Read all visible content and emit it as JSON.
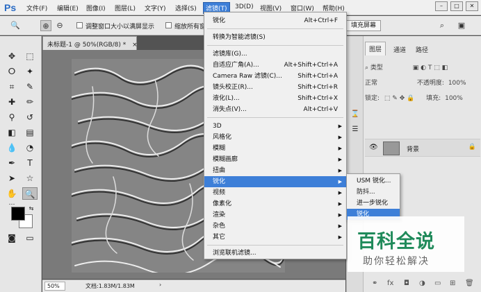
{
  "app": {
    "logo": "Ps"
  },
  "menubar": {
    "items": [
      "文件(F)",
      "编辑(E)",
      "图像(I)",
      "图层(L)",
      "文字(Y)",
      "选择(S)",
      "滤镜(T)",
      "3D(D)",
      "视图(V)",
      "窗口(W)",
      "帮助(H)"
    ],
    "active": "滤镜(T)"
  },
  "window_buttons": {
    "minimize": "–",
    "restore": "□",
    "close": "✕"
  },
  "options_bar": {
    "zoom_icon": "zoom-icon",
    "check1_label": "调整窗口大小以满屏显示",
    "check2_label": "缩放所有窗口",
    "fill_screen": "填充屏幕"
  },
  "document": {
    "tab_title": "未标题-1 @ 50%(RGB/8) *",
    "zoom": "50%",
    "doc_info": "文档:1.83M/1.83M"
  },
  "filter_menu": {
    "last_filter": {
      "label": "锐化",
      "shortcut": "Alt+Ctrl+F"
    },
    "smart": "转换为智能滤镜(S)",
    "group2": [
      {
        "label": "滤镜库(G)...",
        "shortcut": ""
      },
      {
        "label": "自适应广角(A)...",
        "shortcut": "Alt+Shift+Ctrl+A"
      },
      {
        "label": "Camera Raw 滤镜(C)...",
        "shortcut": "Shift+Ctrl+A"
      },
      {
        "label": "镜头校正(R)...",
        "shortcut": "Shift+Ctrl+R"
      },
      {
        "label": "液化(L)...",
        "shortcut": "Shift+Ctrl+X"
      },
      {
        "label": "消失点(V)...",
        "shortcut": "Alt+Ctrl+V"
      }
    ],
    "group3": [
      "3D",
      "风格化",
      "模糊",
      "模糊画廊",
      "扭曲",
      "锐化",
      "视频",
      "像素化",
      "渲染",
      "杂色",
      "其它"
    ],
    "highlighted": "锐化",
    "browse": "浏览联机滤镜..."
  },
  "sharpen_submenu": {
    "items": [
      "USM 锐化...",
      "防抖...",
      "进一步锐化",
      "锐化"
    ],
    "highlighted": "锐化"
  },
  "layers_panel": {
    "tabs": [
      "图层",
      "通道",
      "路径"
    ],
    "active_tab": "图层",
    "filter_kind": "类型",
    "blend_mode": "正常",
    "opacity_label": "不透明度:",
    "opacity_value": "100%",
    "lock_label": "锁定:",
    "fill_label": "填充:",
    "fill_value": "100%",
    "layer_name": "背景"
  },
  "watermark": {
    "title": "百科全说",
    "subtitle": "助你轻松解决"
  },
  "colors": {
    "accent": "#3d7fd8",
    "watermark_green": "#1f8a5a"
  }
}
